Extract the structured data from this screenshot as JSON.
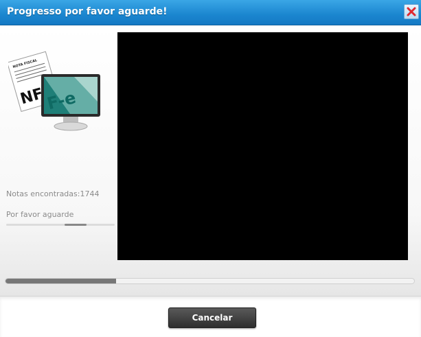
{
  "window": {
    "title": "Progresso por favor aguarde!",
    "close_icon": "close-x-icon",
    "close_color": "#e0282e"
  },
  "sidebar": {
    "illustration": {
      "doc_header": "NOTA FISCAL",
      "doc_big": "NF",
      "screen_text": "F-e"
    },
    "found_label": "Notas encontradas:",
    "found_count": "1744",
    "wait_label": "Por favor aguarde",
    "wait_progress": 0.2
  },
  "main": {
    "progress": 0.27
  },
  "footer": {
    "cancel_label": "Cancelar"
  }
}
